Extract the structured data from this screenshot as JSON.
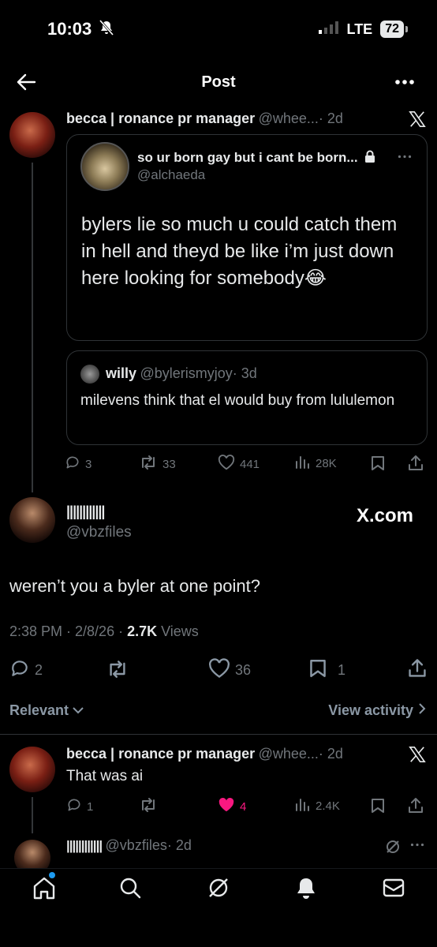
{
  "status": {
    "time": "10:03",
    "network": "LTE",
    "battery": "72"
  },
  "header": {
    "title": "Post"
  },
  "original_post": {
    "name": "becca | ronance pr manager",
    "handle": "@whee...",
    "time": "· 2d",
    "quote": {
      "name": "so ur born gay but i cant be born...",
      "handle": "@alchaeda",
      "text": "bylers lie so much u could catch them in hell and theyd be like i’m just down here looking for somebody😂",
      "inner_quote": {
        "name": "willy",
        "handle": "@bylerismyjoy",
        "time": "· 3d",
        "text": "milevens think that el would buy from lululemon"
      }
    },
    "stats": {
      "replies": "3",
      "reposts": "33",
      "likes": "441",
      "views": "28K"
    }
  },
  "main_post": {
    "name": "||||||||||||",
    "handle": "@vbzfiles",
    "watermark": "X.com",
    "text": "weren’t you a byler at one point?",
    "time": "2:38 PM · 2/8/26 · ",
    "views_count": "2.7K",
    "views_label": " Views",
    "stats": {
      "replies": "2",
      "likes": "36",
      "bookmarks": "1"
    }
  },
  "sort": {
    "relevant": "Relevant",
    "view_activity": "View activity"
  },
  "reply": {
    "name": "becca | ronance pr manager",
    "handle": "@whee...",
    "time": "· 2d",
    "text": "That was ai",
    "stats": {
      "replies": "1",
      "likes": "4",
      "views": "2.4K"
    }
  },
  "next_reply": {
    "name": "||||||||||||",
    "handle": "@vbzfiles",
    "time": "· 2d"
  },
  "colors": {
    "like_active": "#f91880",
    "badge": "#1d9bf0",
    "muted": "#71767b"
  }
}
